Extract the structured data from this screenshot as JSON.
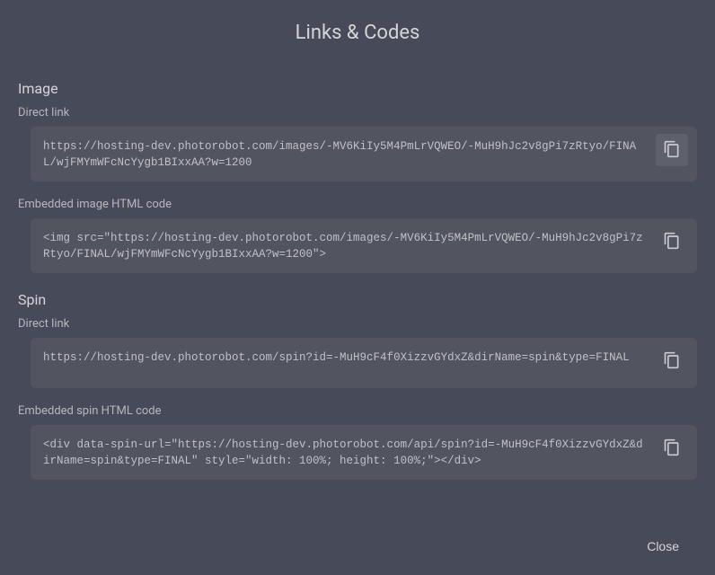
{
  "title": "Links & Codes",
  "sections": {
    "image": {
      "header": "Image",
      "fields": {
        "direct_link": {
          "label": "Direct link",
          "value": "https://hosting-dev.photorobot.com/images/-MV6KiIy5M4PmLrVQWEO/-MuH9hJc2v8gPi7zRtyo/FINAL/wjFMYmWFcNcYygb1BIxxAA?w=1200"
        },
        "embedded_html": {
          "label": "Embedded image HTML code",
          "value": "<img src=\"https://hosting-dev.photorobot.com/images/-MV6KiIy5M4PmLrVQWEO/-MuH9hJc2v8gPi7zRtyo/FINAL/wjFMYmWFcNcYygb1BIxxAA?w=1200\">"
        }
      }
    },
    "spin": {
      "header": "Spin",
      "fields": {
        "direct_link": {
          "label": "Direct link",
          "value": "https://hosting-dev.photorobot.com/spin?id=-MuH9cF4f0XizzvGYdxZ&dirName=spin&type=FINAL"
        },
        "embedded_html": {
          "label": "Embedded spin HTML code",
          "value": "<div data-spin-url=\"https://hosting-dev.photorobot.com/api/spin?id=-MuH9cF4f0XizzvGYdxZ&dirName=spin&type=FINAL\" style=\"width: 100%; height: 100%;\"></div>"
        }
      }
    }
  },
  "footer": {
    "close_label": "Close"
  }
}
